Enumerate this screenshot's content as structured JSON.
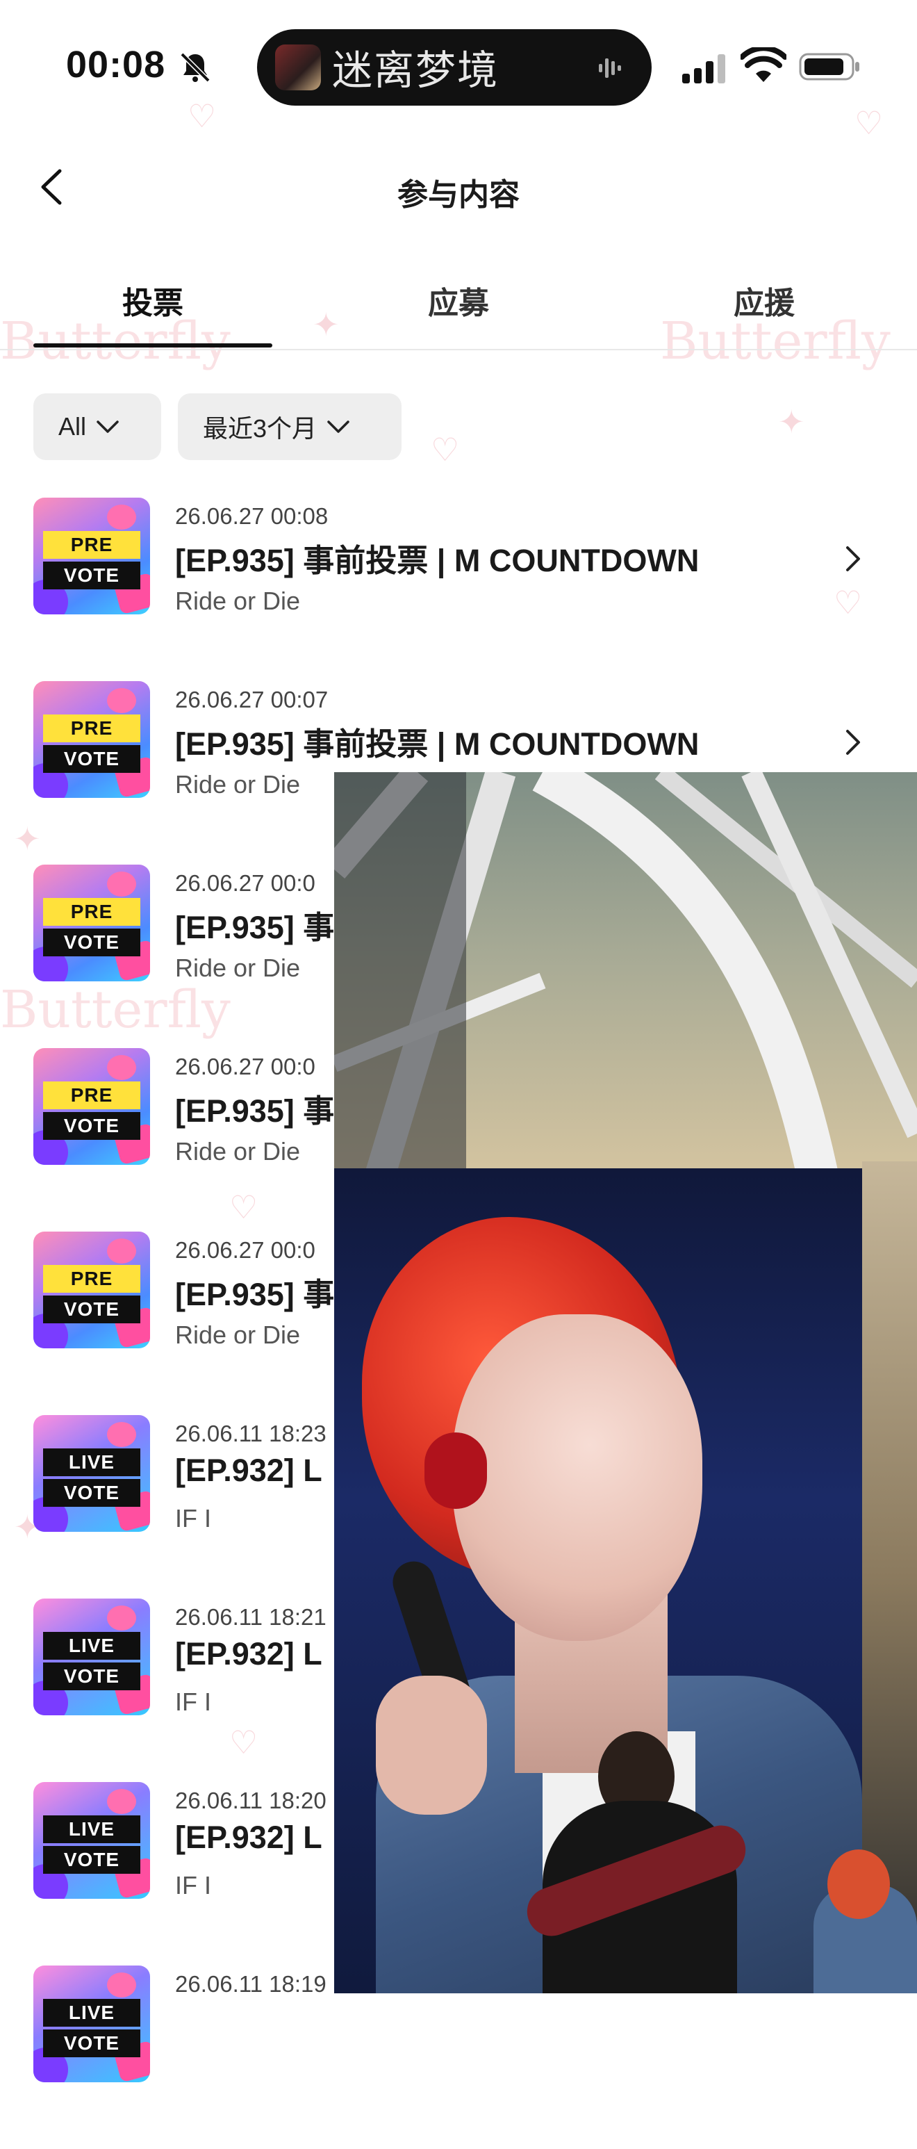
{
  "status_bar": {
    "time": "00:08",
    "island_text": "迷离梦境",
    "icons": [
      "bell-off-icon",
      "signal-icon",
      "wifi-icon",
      "battery-icon"
    ]
  },
  "nav": {
    "title": "参与内容",
    "back_icon": "chevron-left-icon"
  },
  "tabs": [
    {
      "label": "投票",
      "active": true
    },
    {
      "label": "应募",
      "active": false
    },
    {
      "label": "应援",
      "active": false
    }
  ],
  "filters": {
    "category": "All",
    "period": "最近3个月"
  },
  "items": [
    {
      "type": "PRE",
      "badge_top": "PRE",
      "badge_bottom": "VOTE",
      "date": "26.06.27 00:08",
      "title": "[EP.935] 事前投票 | M COUNTDOWN",
      "subtitle": "Ride or Die"
    },
    {
      "type": "PRE",
      "badge_top": "PRE",
      "badge_bottom": "VOTE",
      "date": "26.06.27 00:07",
      "title": "[EP.935] 事前投票 | M COUNTDOWN",
      "subtitle": "Ride or Die"
    },
    {
      "type": "PRE",
      "badge_top": "PRE",
      "badge_bottom": "VOTE",
      "date": "26.06.27 00:0",
      "title": "[EP.935] 事",
      "subtitle": "Ride or Die"
    },
    {
      "type": "PRE",
      "badge_top": "PRE",
      "badge_bottom": "VOTE",
      "date": "26.06.27 00:0",
      "title": "[EP.935] 事",
      "subtitle": "Ride or Die"
    },
    {
      "type": "PRE",
      "badge_top": "PRE",
      "badge_bottom": "VOTE",
      "date": "26.06.27 00:0",
      "title": "[EP.935] 事",
      "subtitle": "Ride or Die"
    },
    {
      "type": "LIVE",
      "badge_top": "LIVE",
      "badge_bottom": "VOTE",
      "date": "26.06.11 18:23",
      "title": "[EP.932] L",
      "subtitle": "IF I"
    },
    {
      "type": "LIVE",
      "badge_top": "LIVE",
      "badge_bottom": "VOTE",
      "date": "26.06.11 18:21",
      "title": "[EP.932] L",
      "subtitle": "IF I"
    },
    {
      "type": "LIVE",
      "badge_top": "LIVE",
      "badge_bottom": "VOTE",
      "date": "26.06.11 18:20",
      "title": "[EP.932] L",
      "subtitle": "IF I"
    },
    {
      "type": "LIVE",
      "badge_top": "LIVE",
      "badge_bottom": "VOTE",
      "date": "26.06.11 18:19",
      "title": "",
      "subtitle": ""
    }
  ],
  "colors": {
    "accent": "#111111",
    "filter_bg": "#eeeeee",
    "wallpaper": "#f6c9cf"
  }
}
